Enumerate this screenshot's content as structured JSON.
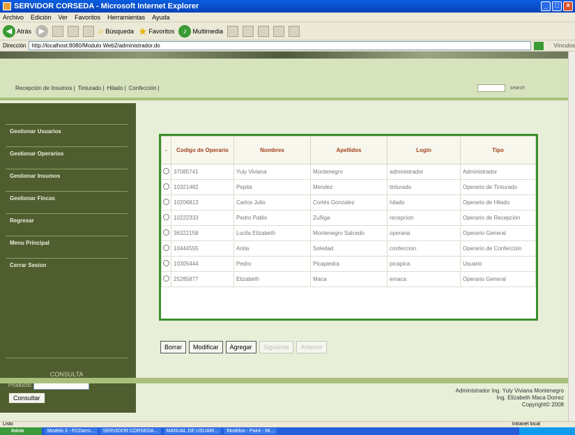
{
  "window": {
    "title": "SERVIDOR CORSEDA - Microsoft Internet Explorer"
  },
  "menu": [
    "Archivo",
    "Edición",
    "Ver",
    "Favoritos",
    "Herramientas",
    "Ayuda"
  ],
  "toolbar": {
    "back": "Atrás",
    "search": "Búsqueda",
    "favorites": "Favoritos",
    "media": "Multimedia"
  },
  "address": {
    "label": "Dirección",
    "url": "http://localhost:8080/Modulo Web2/administrador.do",
    "links": "Vínculos"
  },
  "topnav": {
    "links": [
      "Recepción de Insumos",
      "Tinturado",
      "Hilado",
      "Confección"
    ],
    "search_label": "search"
  },
  "sidebar": {
    "items": [
      "Gestionar Usuarios",
      "Gestionar Operarios",
      "Gestionar Insumos",
      "Gestionar Fincas",
      "Regresar",
      "Menu Principal",
      "Cerrar Sesion"
    ],
    "consulta": {
      "title": "CONSULTA",
      "label": "Producto:",
      "button": "Consultar"
    }
  },
  "table": {
    "headers": [
      "Codigo de Operario",
      "Nombres",
      "Apellidos",
      "Login",
      "Tipo"
    ],
    "rows": [
      [
        "37085741",
        "Yuly Viviana",
        "Montenegro",
        "administrador",
        "Administrador"
      ],
      [
        "10321482",
        "Pepita",
        "Mendez",
        "tinturado",
        "Operario de Tinturado"
      ],
      [
        "10206813",
        "Carlos Julio",
        "Cortés Gonzalez",
        "hilado",
        "Operario de Hilado"
      ],
      [
        "10222333",
        "Pedro Pablo",
        "Zuñiga",
        "recepcion",
        "Operario de Recepción"
      ],
      [
        "36322158",
        "Lucila Elizabeth",
        "Montenegro Salcedo",
        "operaria",
        "Operario General"
      ],
      [
        "10444555",
        "Anita",
        "Soledad",
        "confeccion",
        "Operario de Confección"
      ],
      [
        "10305444",
        "Pedro",
        "Picapiedra",
        "picapica",
        "Usuario"
      ],
      [
        "25285877",
        "Elizabeth",
        "Maca",
        "emaca",
        "Operario General"
      ]
    ]
  },
  "actions": {
    "borrar": "Borrar",
    "modificar": "Modificar",
    "agregar": "Agregar",
    "siguiente": "Siguiente",
    "anterior": "Anterior"
  },
  "credits": {
    "line1": "Administrador Ing. Yuly Viviana Montenegro",
    "line2": "Ing. Elizabeth Maca Dorrez",
    "line3": "Copyright© 2008"
  },
  "status": {
    "left": "Listo",
    "zone": "Intranet local"
  },
  "taskbar": {
    "start": "Inicio",
    "tasks": [
      "Modelo 3 - FCDarro...",
      "SERVIDOR CORSEDA...",
      "MANUAL DE USUARI...",
      "Modelos - Paint - Mi..."
    ]
  }
}
